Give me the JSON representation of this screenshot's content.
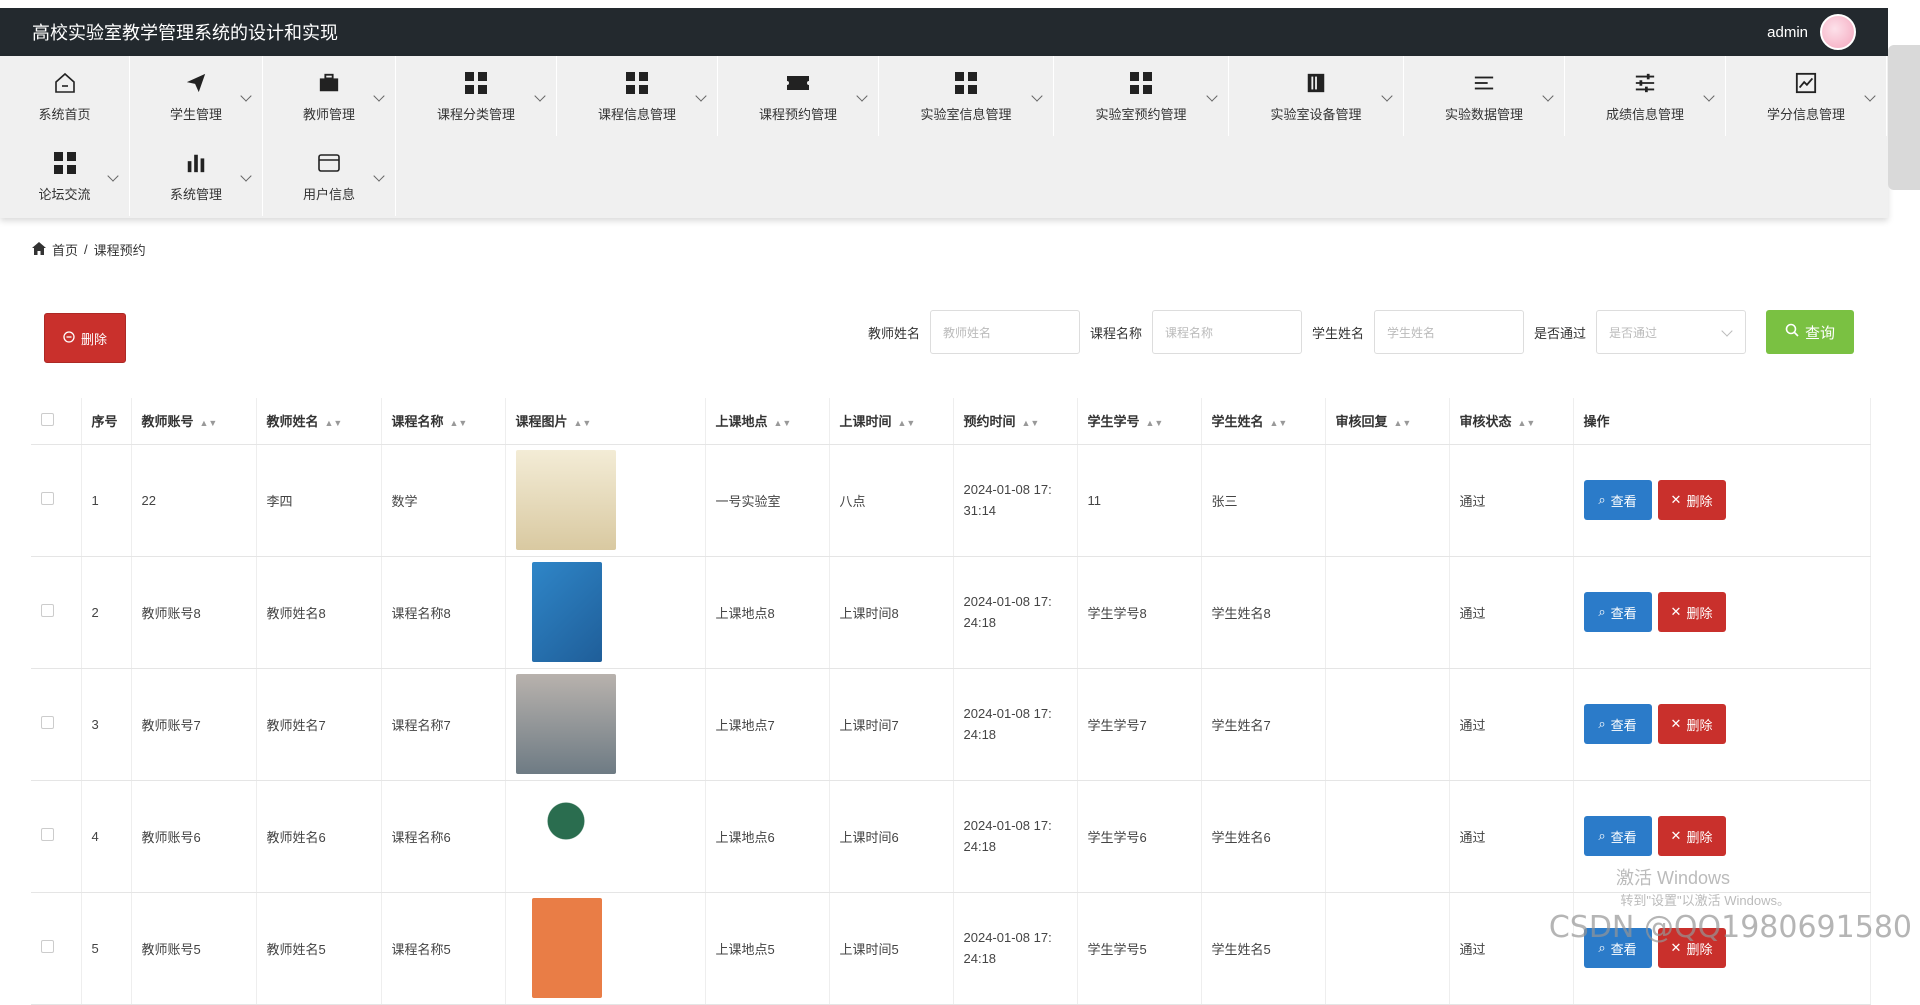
{
  "header": {
    "title": "高校实验室教学管理系统的设计和实现",
    "user": "admin"
  },
  "nav": {
    "row1": [
      {
        "label": "系统首页",
        "icon": "home-icon"
      },
      {
        "label": "学生管理",
        "icon": "paper-plane-icon"
      },
      {
        "label": "教师管理",
        "icon": "briefcase-icon"
      },
      {
        "label": "课程分类管理",
        "icon": "grid-icon"
      },
      {
        "label": "课程信息管理",
        "icon": "grid-icon"
      },
      {
        "label": "课程预约管理",
        "icon": "ticket-icon"
      },
      {
        "label": "实验室信息管理",
        "icon": "grid-icon"
      },
      {
        "label": "实验室预约管理",
        "icon": "grid-icon"
      },
      {
        "label": "实验室设备管理",
        "icon": "building-icon"
      },
      {
        "label": "实验数据管理",
        "icon": "list-icon"
      },
      {
        "label": "成绩信息管理",
        "icon": "sliders-icon"
      },
      {
        "label": "学分信息管理",
        "icon": "chart-icon"
      }
    ],
    "row2": [
      {
        "label": "论坛交流",
        "icon": "grid-icon"
      },
      {
        "label": "系统管理",
        "icon": "bar-chart-icon"
      },
      {
        "label": "用户信息",
        "icon": "card-icon"
      }
    ]
  },
  "breadcrumb": {
    "home": "首页",
    "sep": "/",
    "current": "课程预约"
  },
  "toolbar": {
    "delete_label": "删除"
  },
  "search": {
    "teacher_label": "教师姓名",
    "teacher_placeholder": "教师姓名",
    "course_label": "课程名称",
    "course_placeholder": "课程名称",
    "student_label": "学生姓名",
    "student_placeholder": "学生姓名",
    "pass_label": "是否通过",
    "pass_placeholder": "是否通过",
    "query_label": "查询"
  },
  "table": {
    "headers": [
      "序号",
      "教师账号",
      "教师姓名",
      "课程名称",
      "课程图片",
      "上课地点",
      "上课时间",
      "预约时间",
      "学生学号",
      "学生姓名",
      "审核回复",
      "审核状态",
      "操作"
    ],
    "view_label": "查看",
    "delete_label": "删除",
    "rows": [
      {
        "no": "1",
        "tid": "22",
        "tname": "李四",
        "course": "数学",
        "place": "一号实验室",
        "time": "八点",
        "book1": "2024-01-08 17:",
        "book2": "31:14",
        "sid": "11",
        "sname": "张三",
        "reply": "",
        "status": "通过"
      },
      {
        "no": "2",
        "tid": "教师账号8",
        "tname": "教师姓名8",
        "course": "课程名称8",
        "place": "上课地点8",
        "time": "上课时间8",
        "book1": "2024-01-08 17:",
        "book2": "24:18",
        "sid": "学生学号8",
        "sname": "学生姓名8",
        "reply": "",
        "status": "通过"
      },
      {
        "no": "3",
        "tid": "教师账号7",
        "tname": "教师姓名7",
        "course": "课程名称7",
        "place": "上课地点7",
        "time": "上课时间7",
        "book1": "2024-01-08 17:",
        "book2": "24:18",
        "sid": "学生学号7",
        "sname": "学生姓名7",
        "reply": "",
        "status": "通过"
      },
      {
        "no": "4",
        "tid": "教师账号6",
        "tname": "教师姓名6",
        "course": "课程名称6",
        "place": "上课地点6",
        "time": "上课时间6",
        "book1": "2024-01-08 17:",
        "book2": "24:18",
        "sid": "学生学号6",
        "sname": "学生姓名6",
        "reply": "",
        "status": "通过"
      },
      {
        "no": "5",
        "tid": "教师账号5",
        "tname": "教师姓名5",
        "course": "课程名称5",
        "place": "上课地点5",
        "time": "上课时间5",
        "book1": "2024-01-08 17:",
        "book2": "24:18",
        "sid": "学生学号5",
        "sname": "学生姓名5",
        "reply": "",
        "status": "通过"
      }
    ]
  },
  "overlay": {
    "activate1": "激活 Windows",
    "activate2": "转到\"设置\"以激活 Windows。",
    "csdn": "CSDN @QQ1980691580"
  },
  "colors": {
    "header_bg": "#23292e",
    "danger": "#c9302c",
    "primary": "#2b7bc9",
    "success": "#7ac142"
  }
}
